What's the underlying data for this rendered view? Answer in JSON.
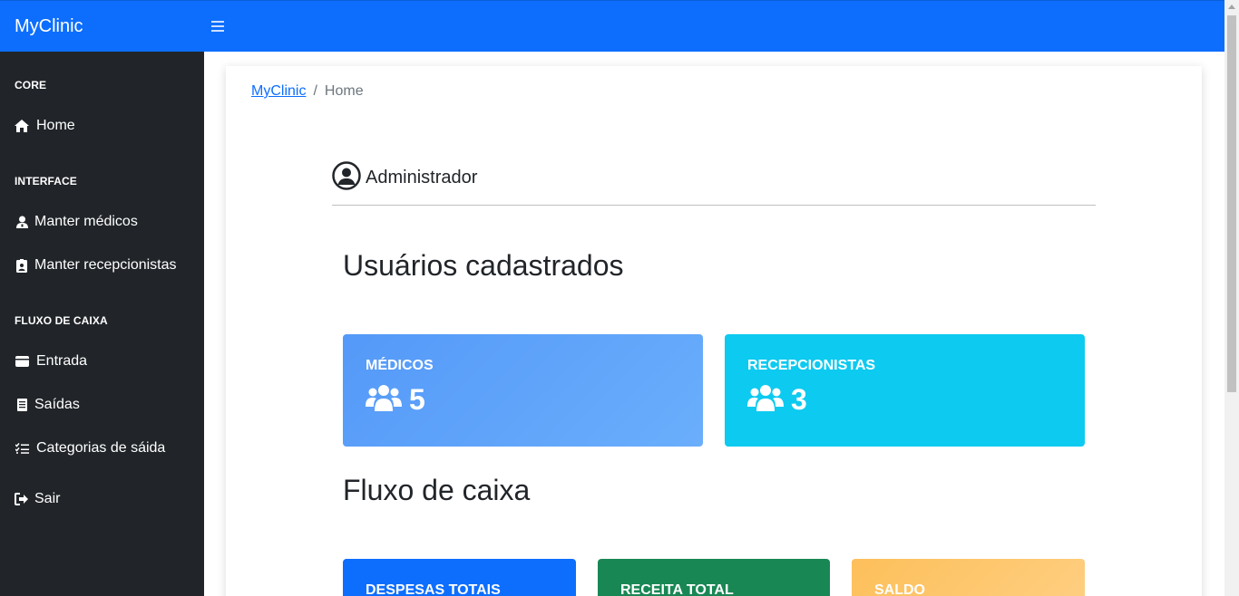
{
  "topbar": {
    "brand": "MyClinic",
    "menu_icon": "hamburger-icon",
    "color": "#0d6efd"
  },
  "sidebar": {
    "background": "#212529",
    "sections": [
      {
        "heading": "CORE",
        "items": [
          {
            "label": "Home",
            "icon": "home-icon"
          }
        ]
      },
      {
        "heading": "INTERFACE",
        "items": [
          {
            "label": "Manter médicos",
            "icon": "doctor-icon"
          },
          {
            "label": "Manter recepcionistas",
            "icon": "id-badge-icon"
          }
        ]
      },
      {
        "heading": "FLUXO DE CAIXA",
        "items": [
          {
            "label": "Entrada",
            "icon": "wallet-icon"
          },
          {
            "label": "Saídas",
            "icon": "receipt-icon"
          },
          {
            "label": "Categorias de sáida",
            "icon": "list-check-icon"
          }
        ]
      }
    ],
    "logout": {
      "label": "Sair",
      "icon": "sign-out-icon"
    }
  },
  "breadcrumb": {
    "link": "MyClinic",
    "separator": "/",
    "current": "Home"
  },
  "admin": {
    "name": "Administrador",
    "icon": "user-circle-icon"
  },
  "users_section": {
    "title": "Usuários cadastrados",
    "cards": [
      {
        "label": "MÉDICOS",
        "value": "5",
        "icon": "users-icon",
        "color": "#5aa2fb"
      },
      {
        "label": "RECEPCIONISTAS",
        "value": "3",
        "icon": "users-icon",
        "color": "#0dcaf0"
      }
    ]
  },
  "cash_section": {
    "title": "Fluxo de caixa",
    "cards": [
      {
        "label": "DESPESAS TOTAIS",
        "color": "#0d6efd"
      },
      {
        "label": "RECEITA TOTAL",
        "color": "#198754"
      },
      {
        "label": "SALDO",
        "color": "#fec66e"
      }
    ]
  }
}
